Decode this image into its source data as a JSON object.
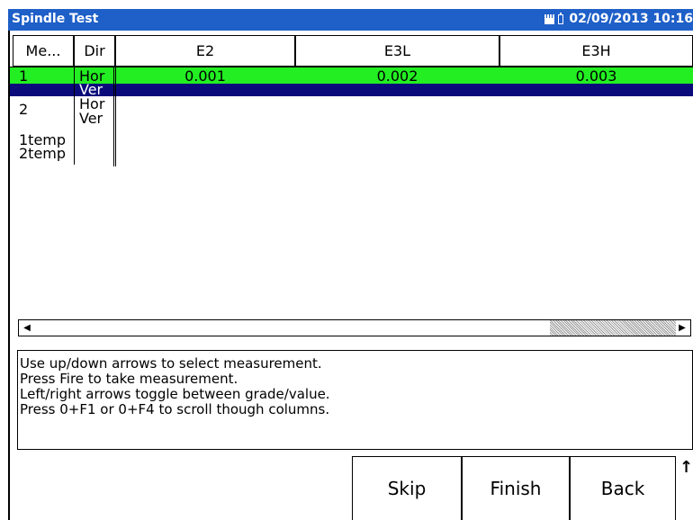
{
  "window": {
    "title": "Spindle Test",
    "datetime": "02/09/2013 10:16"
  },
  "table": {
    "headers": [
      "Me...",
      "Dir",
      "E2",
      "E3L",
      "E3H"
    ],
    "rows": [
      {
        "meas": "1",
        "dir": "Hor",
        "e2": "0.001",
        "e3l": "0.002",
        "e3h": "0.003",
        "state": "selected-green"
      },
      {
        "meas": "",
        "dir": "Ver",
        "e2": "",
        "e3l": "",
        "e3h": "",
        "state": "highlight-blue"
      },
      {
        "meas": "2",
        "dir": "Hor",
        "e2": "",
        "e3l": "",
        "e3h": ""
      },
      {
        "meas": "",
        "dir": "Ver",
        "e2": "",
        "e3l": "",
        "e3h": ""
      },
      {
        "meas": "1temp",
        "dir": "",
        "e2": "",
        "e3l": "",
        "e3h": ""
      },
      {
        "meas": "2temp",
        "dir": "",
        "e2": "",
        "e3l": "",
        "e3h": ""
      }
    ]
  },
  "scrollbar": {
    "left_icon": "left-arrow-icon",
    "right_icon": "right-arrow-icon"
  },
  "instructions": [
    "Use up/down arrows to select measurement.",
    "Press Fire to take measurement.",
    "Left/right arrows toggle between grade/value.",
    "Press 0+F1 or 0+F4 to scroll though columns."
  ],
  "buttons": {
    "skip": "Skip",
    "finish": "Finish",
    "back": "Back"
  },
  "colors": {
    "title_bar": "#1e5fc8",
    "selected_row": "#22ee22",
    "highlight_row": "#0a0a7a"
  }
}
